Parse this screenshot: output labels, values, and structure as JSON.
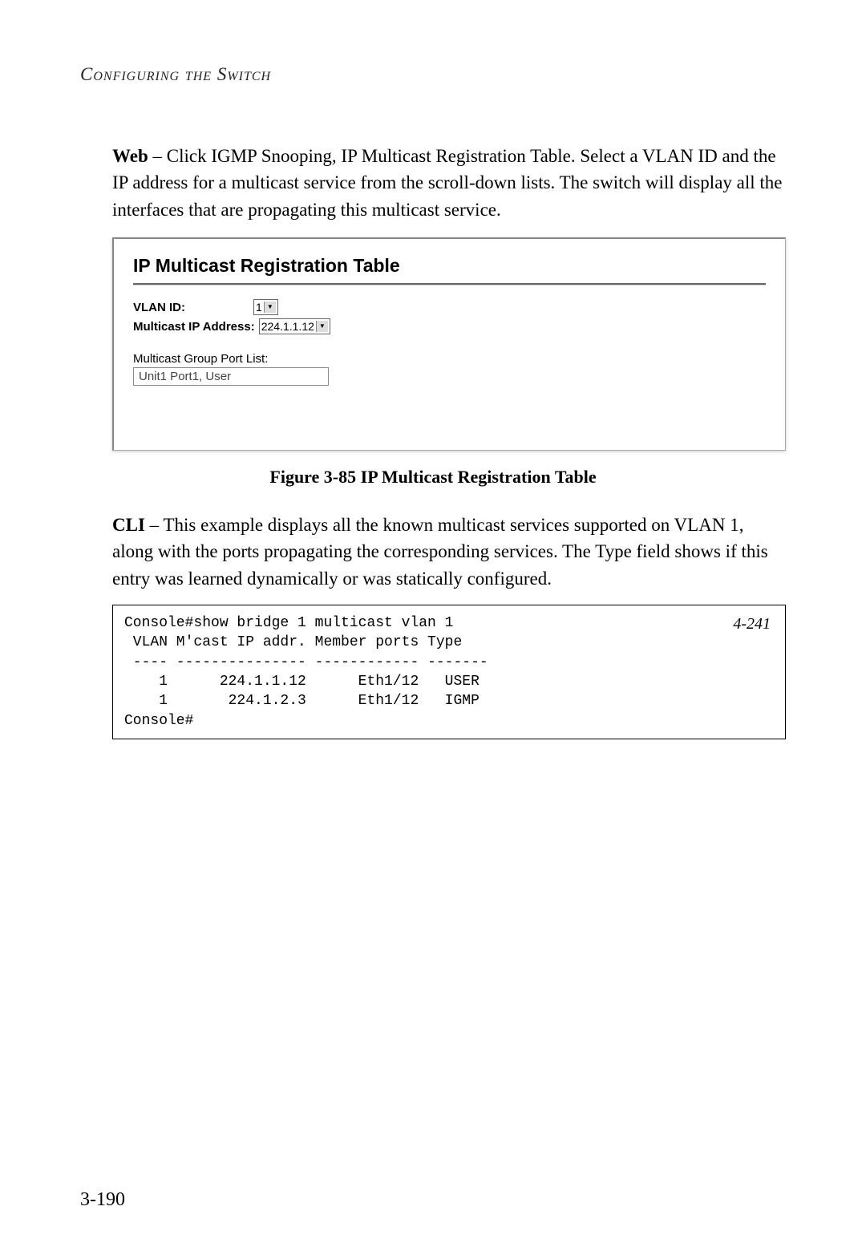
{
  "header": "Configuring the Switch",
  "paragraphs": {
    "web_lead": "Web",
    "web_body": " – Click IGMP Snooping, IP Multicast Registration Table. Select a VLAN ID and the IP address for a multicast service from the scroll-down lists. The switch will display all the interfaces that are propagating this multicast service.",
    "cli_lead": "CLI",
    "cli_body": " – This example displays all the known multicast services supported on VLAN 1, along with the ports propagating the corresponding services. The Type field shows if this entry was learned dynamically or was statically configured."
  },
  "figure": {
    "title": "IP Multicast Registration Table",
    "vlan_label": "VLAN ID:",
    "vlan_value": "1",
    "mcast_label": "Multicast IP Address:",
    "mcast_value": "224.1.1.12",
    "portlist_label": "Multicast Group Port List:",
    "portlist_value": "Unit1 Port1, User"
  },
  "caption": "Figure 3-85  IP Multicast Registration Table",
  "cli": {
    "ref": "4-241",
    "text": "Console#show bridge 1 multicast vlan 1\n VLAN M'cast IP addr. Member ports Type\n ---- --------------- ------------ -------\n    1      224.1.1.12      Eth1/12   USER\n    1       224.1.2.3      Eth1/12   IGMP\nConsole#"
  },
  "page_number": "3-190"
}
